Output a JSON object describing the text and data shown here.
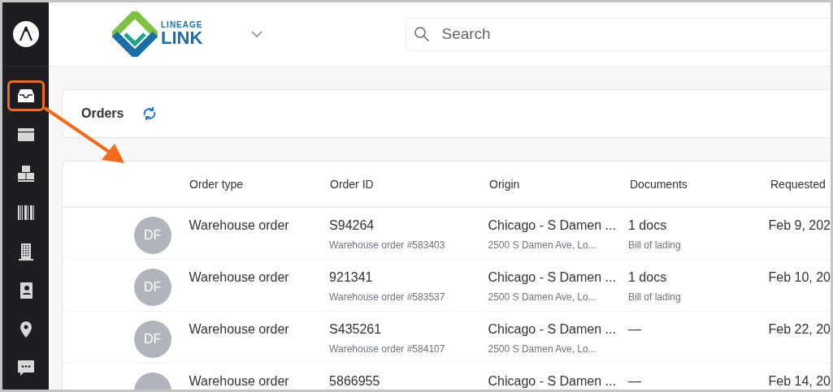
{
  "sidebar": {
    "items": [
      {
        "highlighted": true
      },
      {
        "highlighted": false
      },
      {
        "highlighted": false
      },
      {
        "highlighted": false
      },
      {
        "highlighted": false
      },
      {
        "highlighted": false
      },
      {
        "highlighted": false
      },
      {
        "highlighted": false
      }
    ]
  },
  "header": {
    "logo_top": "LINEAGE",
    "logo_bottom": "LINK",
    "search": {
      "placeholder": "Search"
    }
  },
  "orders_bar": {
    "title": "Orders"
  },
  "table": {
    "columns": [
      "Order type",
      "Order ID",
      "Origin",
      "Documents",
      "Requested"
    ],
    "rows": [
      {
        "avatar": "DF",
        "order_type": "Warehouse order",
        "order_id": "S94264",
        "order_sub": "Warehouse order #583403",
        "origin": "Chicago - S Damen ...",
        "origin_sub": "2500 S Damen Ave, Lo...",
        "documents": "1 docs",
        "documents_sub": "Bill of lading",
        "requested": "Feb 9, 202"
      },
      {
        "avatar": "DF",
        "order_type": "Warehouse order",
        "order_id": "921341",
        "order_sub": "Warehouse order #583537",
        "origin": "Chicago - S Damen ...",
        "origin_sub": "2500 S Damen Ave, Lo...",
        "documents": "1 docs",
        "documents_sub": "Bill of lading",
        "requested": "Feb 10, 20"
      },
      {
        "avatar": "DF",
        "order_type": "Warehouse order",
        "order_id": "S435261",
        "order_sub": "Warehouse order #584107",
        "origin": "Chicago - S Damen ...",
        "origin_sub": "2500 S Damen Ave, Lo...",
        "documents": "—",
        "requested": "Feb 22, 20"
      },
      {
        "order_type": "Warehouse order",
        "order_id": "5866955",
        "origin": "Chicago - S Damen ...",
        "documents": "—",
        "requested": "Feb 14, 20"
      }
    ]
  }
}
